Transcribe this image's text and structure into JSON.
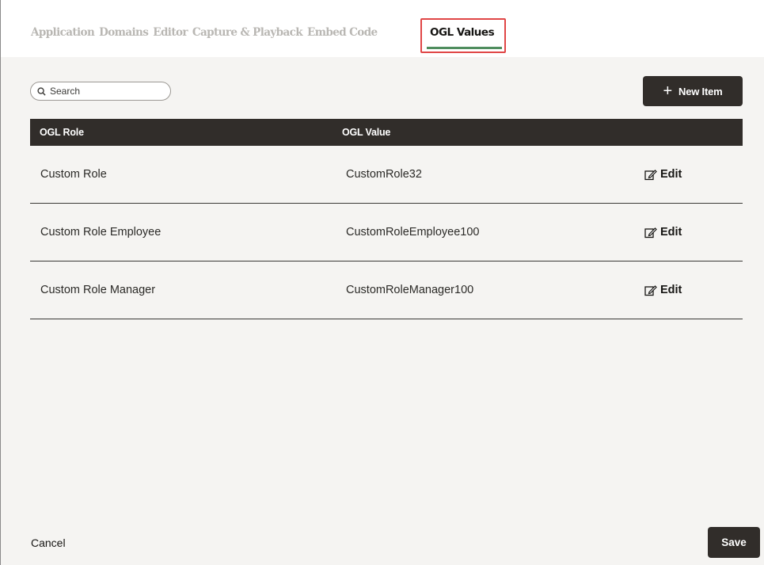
{
  "tabs": {
    "items": [
      {
        "label": "Application"
      },
      {
        "label": "Domains"
      },
      {
        "label": "Editor"
      },
      {
        "label": "Capture & Playback"
      },
      {
        "label": "Embed Code"
      }
    ],
    "active_label": "OGL Values"
  },
  "search": {
    "placeholder": "Search",
    "value": ""
  },
  "new_item": {
    "label": "New Item",
    "icon": "plus-icon"
  },
  "table": {
    "columns": [
      "OGL Role",
      "OGL Value"
    ],
    "rows": [
      {
        "role": "Custom Role",
        "value": "CustomRole32",
        "action": "Edit"
      },
      {
        "role": "Custom Role Employee",
        "value": "CustomRoleEmployee100",
        "action": "Edit"
      },
      {
        "role": "Custom Role Manager",
        "value": "CustomRoleManager100",
        "action": "Edit"
      }
    ]
  },
  "footer": {
    "cancel_label": "Cancel",
    "save_label": "Save"
  },
  "colors": {
    "highlight_border": "#e04646",
    "active_underline": "#4f8d5e",
    "dark_button": "#312d2a",
    "panel_background": "#f5f4f2"
  }
}
